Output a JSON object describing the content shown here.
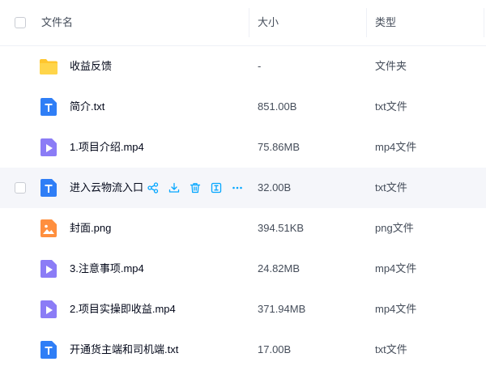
{
  "header": {
    "name_label": "文件名",
    "size_label": "大小",
    "type_label": "类型"
  },
  "rows": [
    {
      "name": "收益反馈",
      "size": "-",
      "type": "文件夹",
      "icon": "folder-icon"
    },
    {
      "name": "简介.txt",
      "size": "851.00B",
      "type": "txt文件",
      "icon": "txt-file-icon"
    },
    {
      "name": "1.项目介绍.mp4",
      "size": "75.86MB",
      "type": "mp4文件",
      "icon": "video-file-icon"
    },
    {
      "name": "进入云物流入口.t",
      "size": "32.00B",
      "type": "txt文件",
      "icon": "txt-file-icon",
      "hovered": true
    },
    {
      "name": "封面.png",
      "size": "394.51KB",
      "type": "png文件",
      "icon": "image-file-icon"
    },
    {
      "name": "3.注意事项.mp4",
      "size": "24.82MB",
      "type": "mp4文件",
      "icon": "video-file-icon"
    },
    {
      "name": "2.项目实操即收益.mp4",
      "size": "371.94MB",
      "type": "mp4文件",
      "icon": "video-file-icon"
    },
    {
      "name": "开通货主端和司机端.txt",
      "size": "17.00B",
      "type": "txt文件",
      "icon": "txt-file-icon"
    }
  ],
  "row_actions": [
    "share-icon",
    "download-icon",
    "delete-icon",
    "rename-icon",
    "more-icon"
  ],
  "colors": {
    "accent": "#06a7ff",
    "folder": "#ffc62e",
    "txt": "#2f7ef6",
    "video": "#8b7cf6",
    "image": "#ff8f3e",
    "hover_bg": "#f5f6fa"
  }
}
